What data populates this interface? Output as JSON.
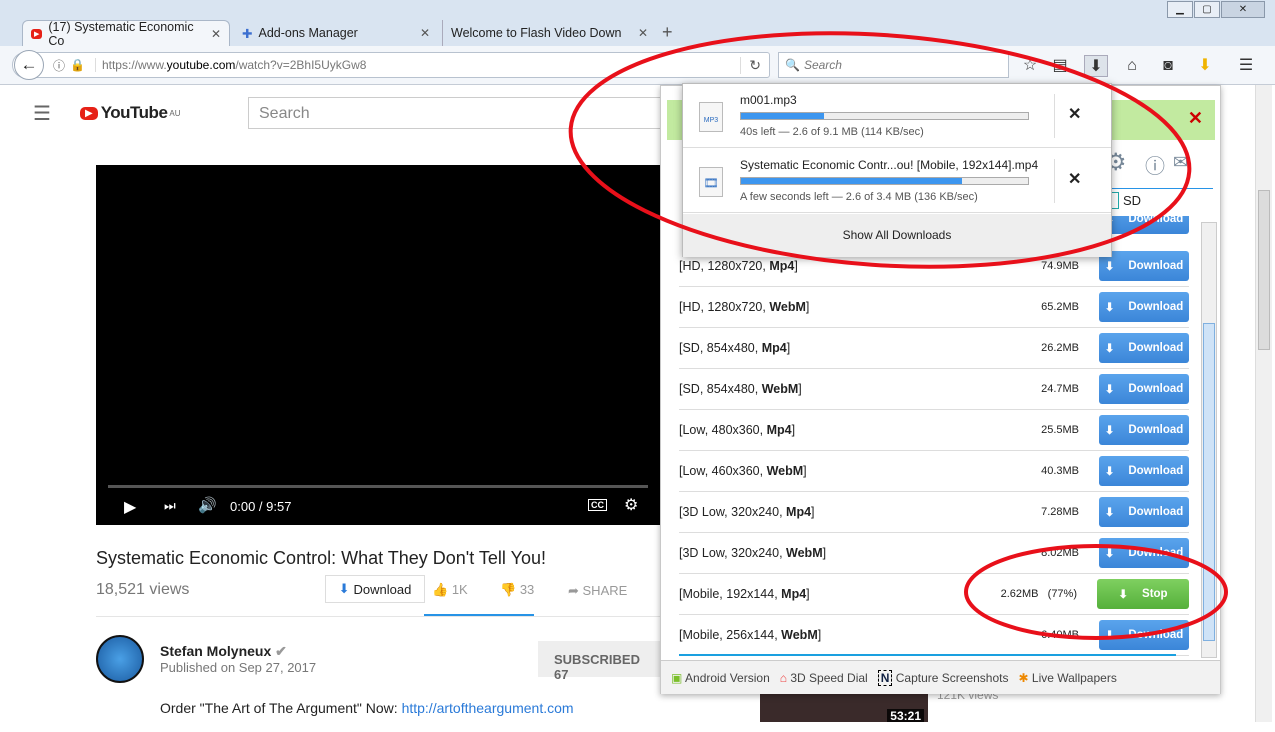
{
  "window": {
    "minimize": "▁",
    "maximize": "▢",
    "close": "✕"
  },
  "tabs": [
    {
      "label": "(17) Systematic Economic Co",
      "close": "✕"
    },
    {
      "label": "Add-ons Manager",
      "close": "✕"
    },
    {
      "label": "Welcome to Flash Video Downloa",
      "close": "✕"
    }
  ],
  "new_tab": "+",
  "url": {
    "prefix": "https://www.",
    "domain": "youtube.com",
    "path": "/watch?v=2BhI5UykGw8"
  },
  "search_placeholder": "Search",
  "youtube": {
    "logo": "YouTube",
    "region": "AU",
    "search_placeholder": "Search",
    "time": "0:00 / 9:57",
    "video_title": "Systematic Economic Control: What They Don't Tell You!",
    "views": "18,521 views",
    "download": "Download",
    "likes": "1K",
    "dislikes": "33",
    "share": "SHARE",
    "channel": "Stefan Molyneux",
    "published": "Published on Sep 27, 2017",
    "subscribed": "SUBSCRIBED",
    "sub_count": "67",
    "desc_text": "Order \"The Art of The Argument\" Now: ",
    "desc_link": "http://artoftheargument.com",
    "thumb_duration": "53:21",
    "thumb_views": "121K views"
  },
  "downloads_popup": {
    "items": [
      {
        "name": "m001.mp3",
        "status": "40s left — 2.6 of 9.1 MB (114 KB/sec)",
        "progress": 0.29,
        "type": "MP3"
      },
      {
        "name": "Systematic Economic Contr...ou! [Mobile, 192x144].mp4",
        "status": "A few seconds left — 2.6 of 3.4 MB (136 KB/sec)",
        "progress": 0.77,
        "type": "video"
      }
    ],
    "show_all": "Show All Downloads",
    "close": "✕"
  },
  "downloader": {
    "quality_label": "SD",
    "rows": [
      {
        "prefix": "[HD, 1280x720, ",
        "fmt": "Mp4",
        "size": "74.9MB",
        "action": "Download"
      },
      {
        "prefix": "[HD, 1280x720, ",
        "fmt": "WebM",
        "size": "65.2MB",
        "action": "Download"
      },
      {
        "prefix": "[SD, 854x480, ",
        "fmt": "Mp4",
        "size": "26.2MB",
        "action": "Download"
      },
      {
        "prefix": "[SD, 854x480, ",
        "fmt": "WebM",
        "size": "24.7MB",
        "action": "Download"
      },
      {
        "prefix": "[Low, 480x360, ",
        "fmt": "Mp4",
        "size": "25.5MB",
        "action": "Download"
      },
      {
        "prefix": "[Low, 460x360, ",
        "fmt": "WebM",
        "size": "40.3MB",
        "action": "Download"
      },
      {
        "prefix": "[3D Low, 320x240, ",
        "fmt": "Mp4",
        "size": "7.28MB",
        "action": "Download"
      },
      {
        "prefix": "[3D Low, 320x240, ",
        "fmt": "WebM",
        "size": "8.02MB",
        "action": "Download"
      },
      {
        "prefix": "[Mobile, 192x144, ",
        "fmt": "Mp4",
        "size": "2.62MB   (77%)",
        "action": "Stop"
      },
      {
        "prefix": "[Mobile, 256x144, ",
        "fmt": "WebM",
        "size": "6.40MB",
        "action": "Download"
      }
    ],
    "footer": [
      "Android Version",
      "3D Speed Dial",
      "Capture Screenshots",
      "Live Wallpapers"
    ],
    "top_download": "Download"
  }
}
